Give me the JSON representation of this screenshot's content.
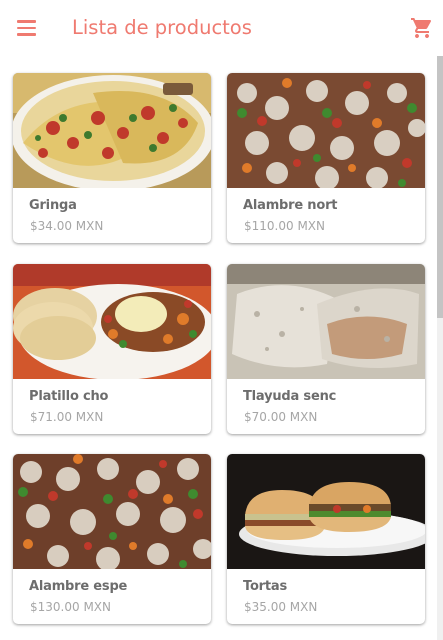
{
  "appbar": {
    "title": "Lista de productos",
    "menu_icon": "menu-icon",
    "cart_icon": "shopping-cart-icon",
    "accent_color": "#ef7a70"
  },
  "products": [
    {
      "name": "Gringa",
      "price": "$34.00 MXN"
    },
    {
      "name": "Alambre nort",
      "price": "$110.00 MXN"
    },
    {
      "name": "Platillo cho",
      "price": "$71.00 MXN"
    },
    {
      "name": "Tlayuda senc",
      "price": "$70.00 MXN"
    },
    {
      "name": "Alambre espe",
      "price": "$130.00 MXN"
    },
    {
      "name": "Tortas",
      "price": "$35.00 MXN"
    }
  ]
}
